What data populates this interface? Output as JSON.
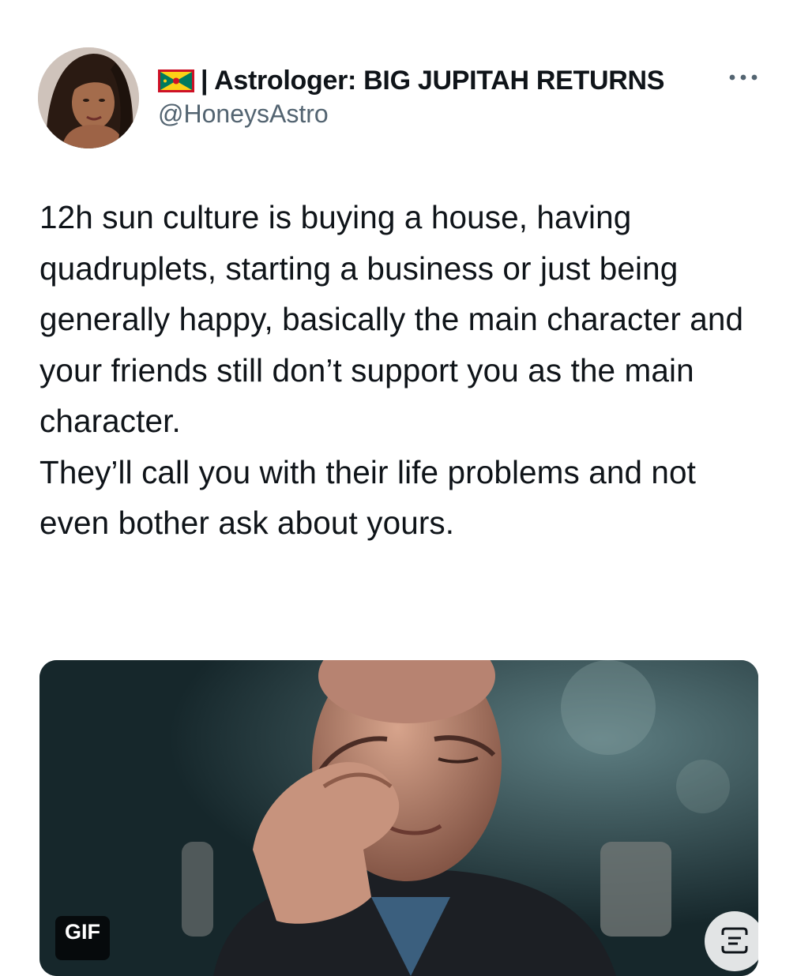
{
  "tweet": {
    "author": {
      "display_name": "| Astrologer: BIG JUPITAH RETURNS",
      "flag_icon": "grenada-flag-icon",
      "handle": "@HoneysAstro"
    },
    "more_icon": "more-options-icon",
    "text_paragraphs": [
      "12h sun culture is buying a house, having quadruplets, starting a business or just being generally happy, basically the main character and your friends still don’t support you as the main character.",
      "They’ll call you with their life problems and not even bother ask about yours."
    ],
    "media": {
      "type": "gif",
      "badge_label": "GIF",
      "alt_icon": "alt-text-icon"
    }
  },
  "colors": {
    "text": "#0f1419",
    "secondary_text": "#536471",
    "flag_red": "#ce1126",
    "flag_yellow": "#fcd116",
    "flag_green": "#007a5e"
  }
}
